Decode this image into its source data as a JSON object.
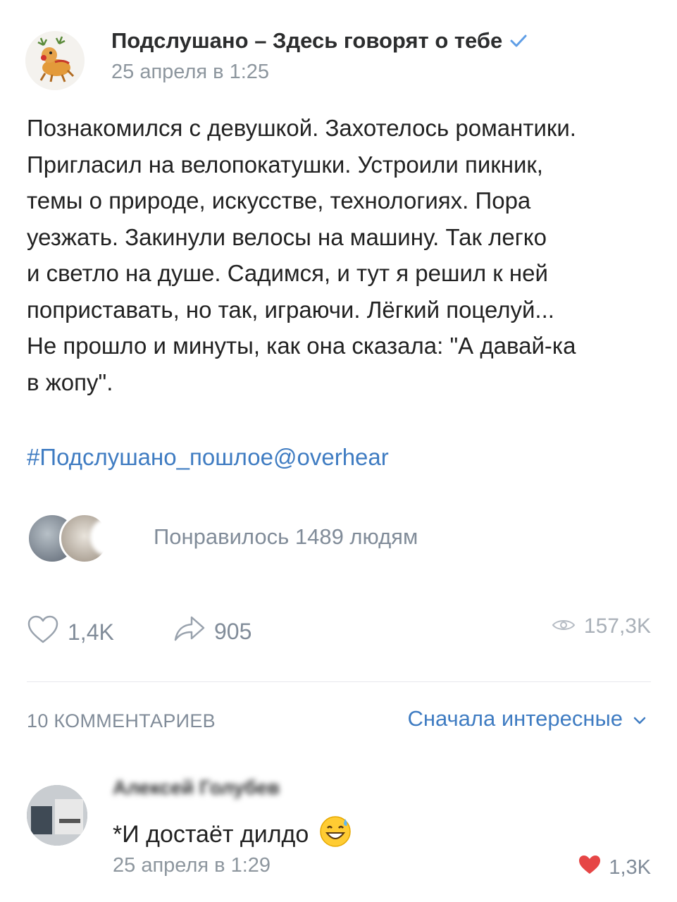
{
  "post": {
    "community_name": "Подслушано – Здесь говорят о тебе",
    "date": "25 апреля в 1:25",
    "text": "Познакомился с девушкой. Захотелось романтики.\nПригласил на велопокатушки. Устроили пикник,\nтемы о природе, искусстве, технологиях. Пора\nуезжать. Закинули велосы на машину. Так легко\nи светло на душе. Садимся, и тут я решил к ней\nпоприставать, но так, играючи. Лёгкий поцелуй...\nНе прошло и минуты, как она сказала: \"А давай-ка\nв жопу\".",
    "hashtag": "#Подслушано_пошлое@overhear",
    "likes_summary": "Понравилось 1489 людям"
  },
  "actions": {
    "likes_count": "1,4K",
    "shares_count": "905",
    "views_count": "157,3K"
  },
  "comments": {
    "count_label": "10 КОММЕНТАРИЕВ",
    "sort_label": "Сначала интересные",
    "items": [
      {
        "author": "Алексей Голубев",
        "text": "*И достаёт дилдо",
        "date": "25 апреля в 1:29",
        "likes": "1,3K"
      }
    ]
  },
  "icons": {
    "verified": "verified-check-icon",
    "like": "heart-outline-icon",
    "share": "share-arrow-icon",
    "views": "eye-icon",
    "sort": "chevron-down-icon",
    "comment_like": "heart-filled-icon"
  },
  "colors": {
    "link": "#3f7cc2",
    "muted": "#818c99",
    "heart": "#e64646"
  }
}
